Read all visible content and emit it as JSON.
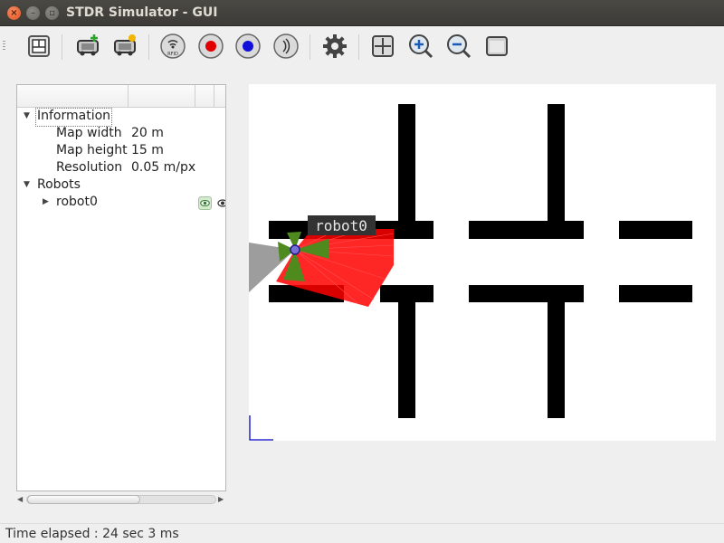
{
  "window": {
    "title": "STDR Simulator - GUI"
  },
  "toolbar": {
    "buttons": [
      {
        "name": "load-map",
        "icon": "map-icon"
      },
      {
        "name": "add-robot",
        "icon": "robot-add-icon"
      },
      {
        "name": "load-robot",
        "icon": "robot-load-icon"
      },
      {
        "name": "add-rfid",
        "icon": "rfid-icon",
        "caption": "RFID"
      },
      {
        "name": "add-co2",
        "icon": "red-dot-icon"
      },
      {
        "name": "add-thermal",
        "icon": "blue-dot-icon"
      },
      {
        "name": "add-sound",
        "icon": "sound-icon"
      },
      {
        "name": "properties",
        "icon": "gear-icon"
      },
      {
        "name": "grid",
        "icon": "grid-icon"
      },
      {
        "name": "zoom-in",
        "icon": "zoom-in-icon"
      },
      {
        "name": "zoom-out",
        "icon": "zoom-out-icon"
      },
      {
        "name": "adjusted-view",
        "icon": "window-icon"
      }
    ]
  },
  "tree": {
    "information": {
      "label": "Information",
      "rows": [
        {
          "key": "Map width",
          "value": "20 m"
        },
        {
          "key": "Map height",
          "value": "15 m"
        },
        {
          "key": "Resolution",
          "value": "0.05 m/px"
        }
      ]
    },
    "robots": {
      "label": "Robots",
      "items": [
        {
          "label": "robot0"
        }
      ]
    }
  },
  "map": {
    "robot_label": "robot0"
  },
  "status": {
    "text": "Time elapsed : 24 sec 3 ms"
  },
  "colors": {
    "laser": "#ff0000",
    "sonar": "#4f8a1e",
    "fov": "#9d9d9d",
    "obstacle": "#000000",
    "origin": "#0000c8"
  }
}
